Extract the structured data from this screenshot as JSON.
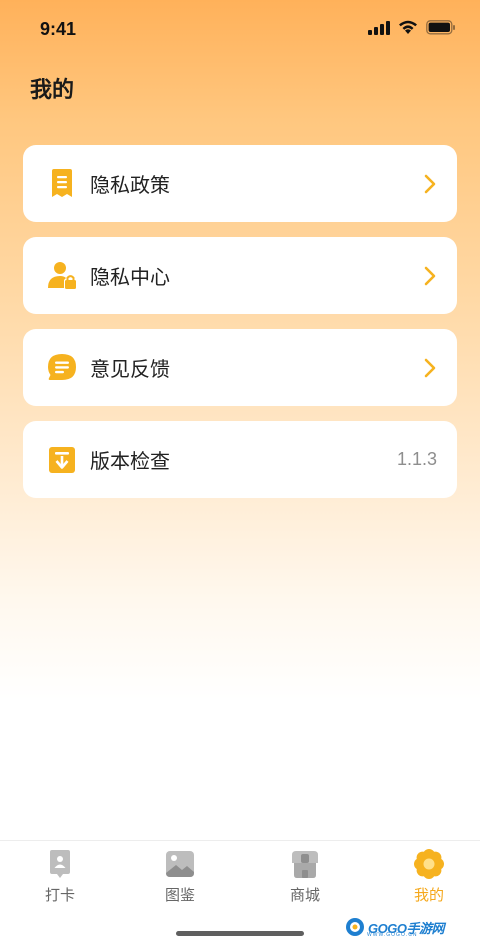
{
  "status_bar": {
    "time": "9:41"
  },
  "page": {
    "title": "我的"
  },
  "menu": [
    {
      "label": "隐私政策",
      "icon": "document-icon",
      "trailing": "chevron"
    },
    {
      "label": "隐私中心",
      "icon": "user-lock-icon",
      "trailing": "chevron"
    },
    {
      "label": "意见反馈",
      "icon": "chat-bubble-icon",
      "trailing": "chevron"
    },
    {
      "label": "版本检查",
      "icon": "download-icon",
      "trailing": "value",
      "value": "1.1.3"
    }
  ],
  "tab_bar": {
    "tabs": [
      {
        "label": "打卡",
        "icon": "checkin-icon",
        "active": false
      },
      {
        "label": "图鉴",
        "icon": "image-gallery-icon",
        "active": false
      },
      {
        "label": "商城",
        "icon": "shop-icon",
        "active": false
      },
      {
        "label": "我的",
        "icon": "flower-profile-icon",
        "active": true
      }
    ]
  },
  "watermark": {
    "text": "GOGO手游网",
    "subtext": "WWW.GOGO.CN"
  },
  "colors": {
    "accent": "#F5A81C",
    "icon_yellow": "#F6B21F",
    "inactive": "#BDBDBD",
    "gradient_top": "#FFB15A"
  }
}
